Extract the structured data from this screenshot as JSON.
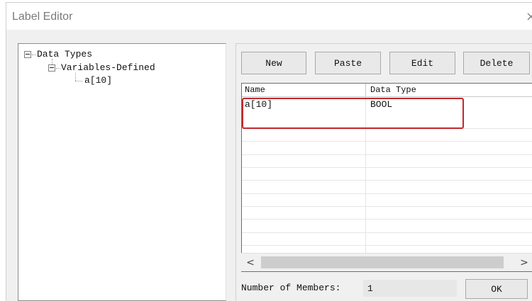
{
  "window": {
    "title": "Label Editor",
    "close_glyph": "×"
  },
  "tree": {
    "root": "Data Types",
    "child": "Variables-Defined",
    "leaf": "a[10]"
  },
  "toolbar": {
    "new_label": "New",
    "paste_label": "Paste",
    "edit_label": "Edit",
    "delete_label": "Delete"
  },
  "table": {
    "columns": [
      "Name",
      "Data Type"
    ],
    "rows": [
      {
        "name": "a[10]",
        "data_type": "BOOL"
      }
    ]
  },
  "scrollbar": {
    "left_arrow": "<",
    "right_arrow": ">"
  },
  "footer": {
    "members_label": "Number of Members:",
    "members_value": "1",
    "ok_label": "OK"
  },
  "colors": {
    "highlight_border": "#c1272d"
  }
}
